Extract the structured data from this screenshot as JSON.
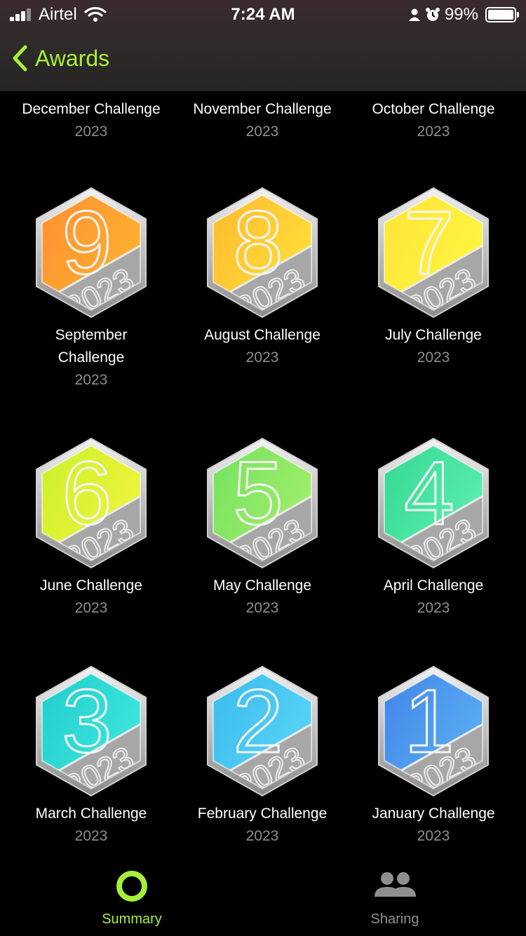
{
  "status": {
    "carrier": "Airtel",
    "time": "7:24 AM",
    "battery": "99%"
  },
  "nav": {
    "back_label": "Awards"
  },
  "colors": {
    "accent": "#a6f03a",
    "secondary_text": "#8e8e93"
  },
  "awards": [
    {
      "title": "December Challenge",
      "year": "2023"
    },
    {
      "title": "November Challenge",
      "year": "2023"
    },
    {
      "title": "October Challenge",
      "year": "2023"
    },
    {
      "title": "September Challenge",
      "year": "2023",
      "digit": "9",
      "colors": [
        "#ff8a34",
        "#ffb52e"
      ]
    },
    {
      "title": "August Challenge",
      "year": "2023",
      "digit": "8",
      "colors": [
        "#ffb52e",
        "#ffe23a"
      ]
    },
    {
      "title": "July Challenge",
      "year": "2023",
      "digit": "7",
      "colors": [
        "#ffe23a",
        "#fff73f"
      ]
    },
    {
      "title": "June Challenge",
      "year": "2023",
      "digit": "6",
      "colors": [
        "#c6ef2a",
        "#f2f53b"
      ]
    },
    {
      "title": "May Challenge",
      "year": "2023",
      "digit": "5",
      "colors": [
        "#6ee060",
        "#a6ef6a"
      ]
    },
    {
      "title": "April Challenge",
      "year": "2023",
      "digit": "4",
      "colors": [
        "#2fd68f",
        "#5ef0b0"
      ]
    },
    {
      "title": "March Challenge",
      "year": "2023",
      "digit": "3",
      "colors": [
        "#1fc9c9",
        "#3fe9e0"
      ]
    },
    {
      "title": "February Challenge",
      "year": "2023",
      "digit": "2",
      "colors": [
        "#38b8ee",
        "#5ad6f5"
      ]
    },
    {
      "title": "January Challenge",
      "year": "2023",
      "digit": "1",
      "colors": [
        "#3f7fe8",
        "#5cb2f2"
      ]
    }
  ],
  "tabs": [
    {
      "label": "Summary",
      "icon": "activity-ring-icon",
      "active": true
    },
    {
      "label": "Sharing",
      "icon": "people-icon",
      "active": false
    }
  ]
}
